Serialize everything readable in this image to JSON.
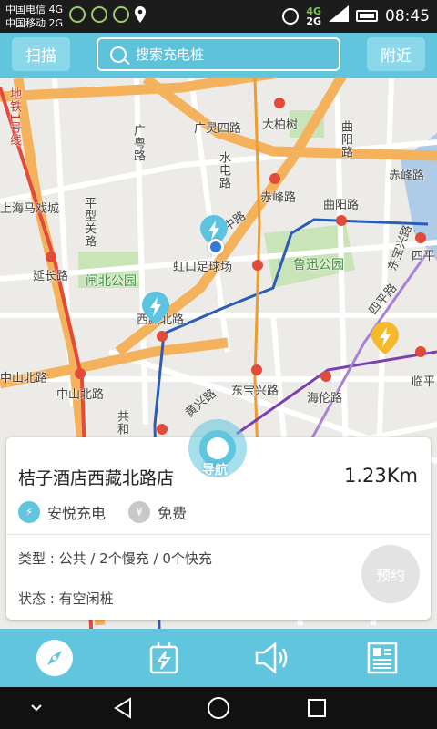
{
  "status_bar": {
    "carrier1": "中国电信 4G",
    "carrier2": "中国移动 2G",
    "net1": "4G",
    "net2": "2G",
    "time": "08:45"
  },
  "header": {
    "scan_label": "扫描",
    "nearby_label": "附近",
    "search_placeholder": "搜索充电桩"
  },
  "map": {
    "labels": [
      "广灵四路",
      "大柏树",
      "曲阳路",
      "赤峰路",
      "曲阳路",
      "赤峰路",
      "上海马戏城",
      "延长路",
      "闸北公园",
      "虹口足球场",
      "鲁迅公园",
      "西藏北路",
      "中山北路",
      "中山北路",
      "东宝兴路",
      "海伦路",
      "四平",
      "临平",
      "广粤路",
      "水电路",
      "广中路",
      "平型关路",
      "地铁1号线",
      "共和",
      "四平路",
      "黄兴路",
      "东宝兴路"
    ],
    "navigate_label": "导航"
  },
  "card": {
    "name": "桔子酒店西藏北路店",
    "distance": "1.23Km",
    "operator": "安悦充电",
    "fee": "免费",
    "type_line": "类型 : 公共 / 2个慢充 / 0个快充",
    "status_line": "状态 : 有空闲桩",
    "reserve_label": "预约"
  },
  "tabs": [
    {
      "icon": "compass-icon"
    },
    {
      "icon": "charger-icon"
    },
    {
      "icon": "speaker-icon"
    },
    {
      "icon": "news-icon"
    }
  ],
  "colors": {
    "accent": "#61c5de",
    "pin_blue": "#5cc3e0",
    "pin_yellow": "#f7b92c",
    "metro_red": "#e24a3a"
  }
}
